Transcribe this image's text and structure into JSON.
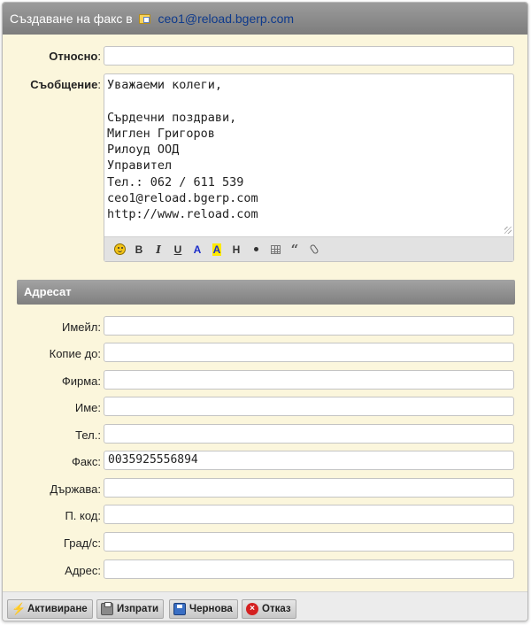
{
  "window": {
    "title": "Създаване на факс в",
    "account": "ceo1@reload.bgerp.com"
  },
  "form": {
    "subject": {
      "label": "Относно",
      "value": ""
    },
    "message": {
      "label": "Съобщение",
      "value": "Уважаеми колеги,\n\nСърдечни поздрави,\nМиглен Григоров\nРилоуд ООД\nУправител\nТел.: 062 / 611 539\nceo1@reload.bgerp.com\nhttp://www.reload.com"
    }
  },
  "editor_toolbar": [
    {
      "name": "smiley-icon",
      "label": ""
    },
    {
      "name": "bold-button",
      "label": "B"
    },
    {
      "name": "italic-button",
      "label": "I"
    },
    {
      "name": "underline-button",
      "label": "U"
    },
    {
      "name": "text-color-button",
      "label": "A"
    },
    {
      "name": "highlight-button",
      "label": "A"
    },
    {
      "name": "heading-button",
      "label": "H"
    },
    {
      "name": "bullet-list-icon",
      "label": ""
    },
    {
      "name": "table-icon",
      "label": ""
    },
    {
      "name": "quote-icon",
      "label": "66"
    },
    {
      "name": "attachment-icon",
      "label": ""
    }
  ],
  "recipient_section": {
    "title": "Адресат",
    "fields": [
      {
        "label": "Имейл:",
        "value": ""
      },
      {
        "label": "Копие до:",
        "value": ""
      },
      {
        "label": "Фирма:",
        "value": ""
      },
      {
        "label": "Име:",
        "value": ""
      },
      {
        "label": "Тел.:",
        "value": ""
      },
      {
        "label": "Факс:",
        "value": "0035925556894"
      },
      {
        "label": "Държава:",
        "value": ""
      },
      {
        "label": "П. код:",
        "value": ""
      },
      {
        "label": "Град/с:",
        "value": ""
      },
      {
        "label": "Адрес:",
        "value": ""
      }
    ]
  },
  "footer": {
    "activate": "Активиране",
    "send": "Изпрати",
    "draft": "Чернова",
    "cancel": "Отказ"
  },
  "icons": {
    "title": "account-card-icon",
    "activate": "lightning-icon",
    "send": "printer-icon",
    "draft": "floppy-disk-icon",
    "cancel": "cancel-icon"
  },
  "colors": {
    "form_background": "#fbf6dc",
    "titlebar": "#8c8c8c",
    "link": "#0e3a8c",
    "highlight": "#ffea00"
  }
}
